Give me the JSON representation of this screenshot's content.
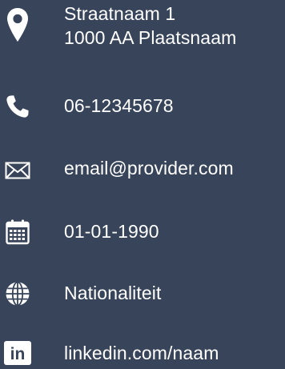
{
  "contact": {
    "address": {
      "icon": "location-pin-icon",
      "line1": "Straatnaam 1",
      "line2": "1000 AA Plaatsnaam"
    },
    "phone": {
      "icon": "phone-icon",
      "value": "06-12345678"
    },
    "email": {
      "icon": "envelope-icon",
      "value": "email@provider.com"
    },
    "birthdate": {
      "icon": "calendar-icon",
      "value": "01-01-1990"
    },
    "nationality": {
      "icon": "globe-icon",
      "value": "Nationaliteit"
    },
    "linkedin": {
      "icon": "linkedin-icon",
      "logo_text": "in",
      "value": "linkedin.com/naam"
    }
  },
  "colors": {
    "background": "#37445a",
    "foreground": "#ffffff"
  }
}
